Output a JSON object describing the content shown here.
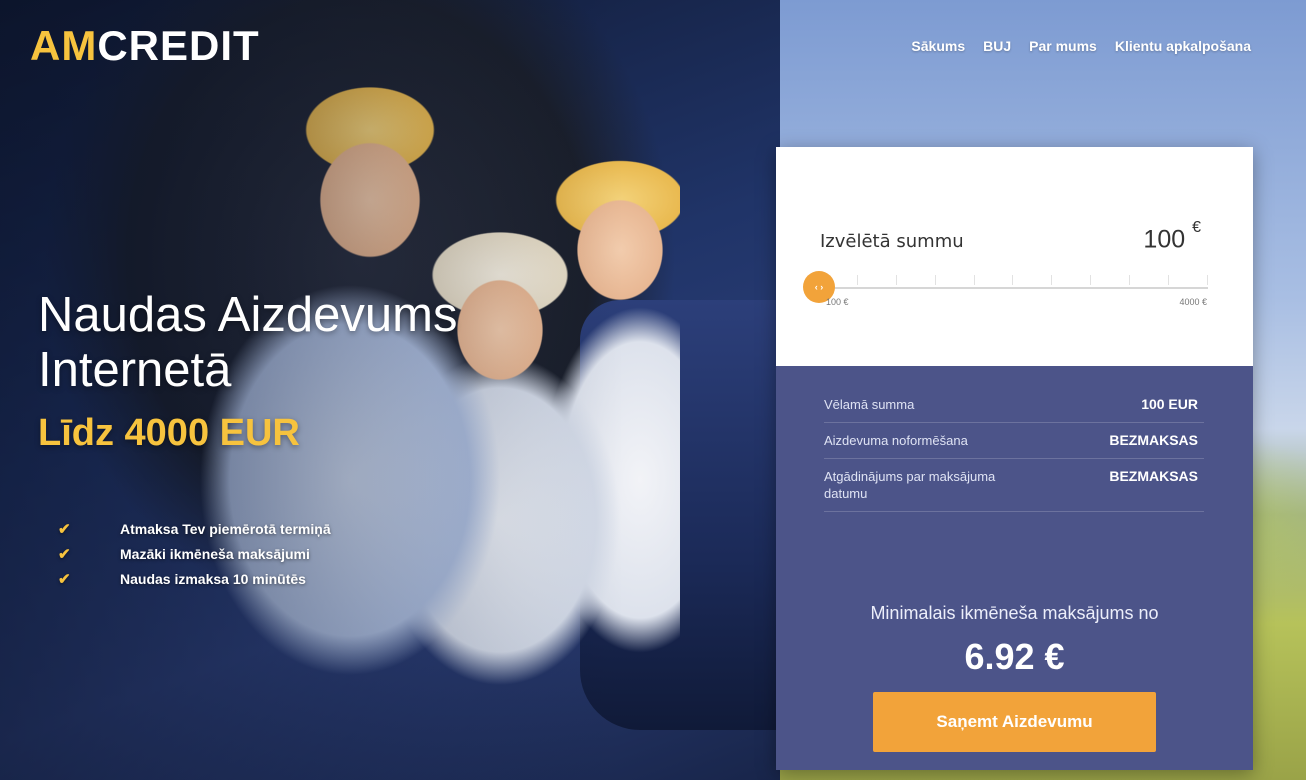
{
  "brand": {
    "logo_accent": "AM",
    "logo_rest": "CREDIT"
  },
  "nav": {
    "items": [
      "Sākums",
      "BUJ",
      "Par mums",
      "Klientu apkalpošana"
    ]
  },
  "hero": {
    "headline_line1": "Naudas Aizdevums",
    "headline_line2": "Internetā",
    "subheadline": "Līdz 4000 EUR",
    "benefits": [
      "Atmaksa Tev piemērotā termiņā",
      "Mazāki ikmēneša maksājumi",
      "Naudas izmaksa 10 minūtēs"
    ]
  },
  "calculator": {
    "selected_label": "Izvēlētā summu",
    "selected_value": "100",
    "currency_symbol": "€",
    "slider_handle_glyph": "‹ ›",
    "slider_min": "100 €",
    "slider_max": "4000 €",
    "slider_value": 100,
    "rows": [
      {
        "label": "Vēlamā summa",
        "value": "100 EUR"
      },
      {
        "label": "Aizdevuma noformēšana",
        "value": "BEZMAKSAS"
      },
      {
        "label": "Atgādinājums par maksājuma datumu",
        "value": "BEZMAKSAS"
      }
    ],
    "min_payment_label": "Minimalais ikmēneša maksājums no",
    "min_payment_value": "6.92 €",
    "cta_label": "Saņemt Aizdevumu"
  },
  "colors": {
    "accent": "#f7c33e",
    "cta": "#f2a33a",
    "panel": "#4c5489"
  }
}
